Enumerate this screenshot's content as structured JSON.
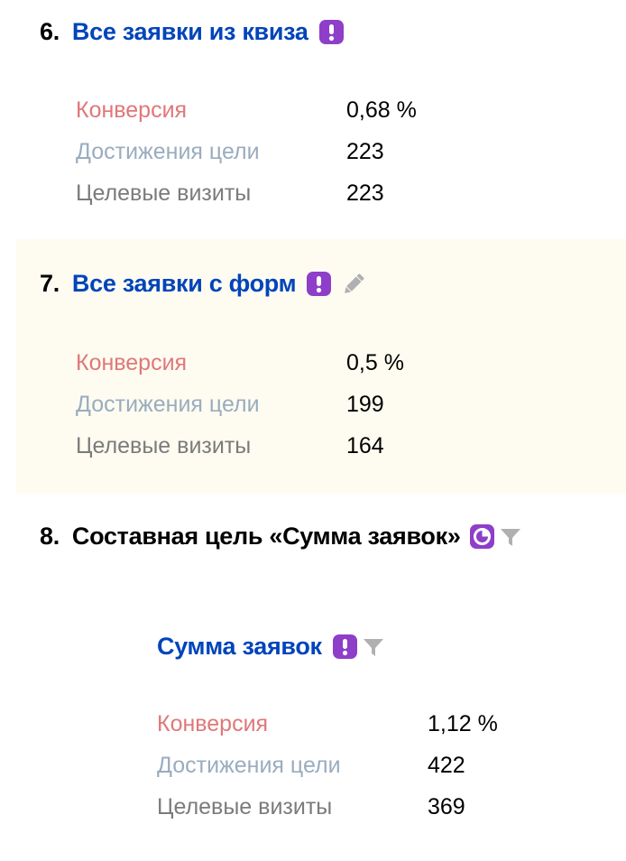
{
  "goals": [
    {
      "number": "6.",
      "name": "Все заявки из квиза",
      "stats": {
        "conversion_label": "Конверсия",
        "conversion_value": "0,68 %",
        "reaches_label": "Достижения цели",
        "reaches_value": "223",
        "visits_label": "Целевые визиты",
        "visits_value": "223"
      }
    },
    {
      "number": "7.",
      "name": "Все заявки с форм",
      "stats": {
        "conversion_label": "Конверсия",
        "conversion_value": "0,5 %",
        "reaches_label": "Достижения цели",
        "reaches_value": "199",
        "visits_label": "Целевые визиты",
        "visits_value": "164"
      }
    },
    {
      "number": "8.",
      "name": "Составная цель «Сумма заявок»",
      "sub": {
        "name": "Сумма заявок",
        "stats": {
          "conversion_label": "Конверсия",
          "conversion_value": "1,12 %",
          "reaches_label": "Достижения цели",
          "reaches_value": "422",
          "visits_label": "Целевые визиты",
          "visits_value": "369"
        }
      }
    }
  ],
  "colors": {
    "goal_link": "#0044bb",
    "badge": "#8e3ec9",
    "conversion_label": "#e0777a",
    "reaches_label": "#9aacbf",
    "visits_label": "#7b7b7b",
    "highlight_bg": "#fefcf1",
    "muted_icon": "#b0b0b0"
  },
  "icons": {
    "alert_badge": "exclamation-badge-icon",
    "composite_badge": "pie-chart-badge-icon",
    "edit": "pencil-icon",
    "filter": "funnel-icon"
  }
}
